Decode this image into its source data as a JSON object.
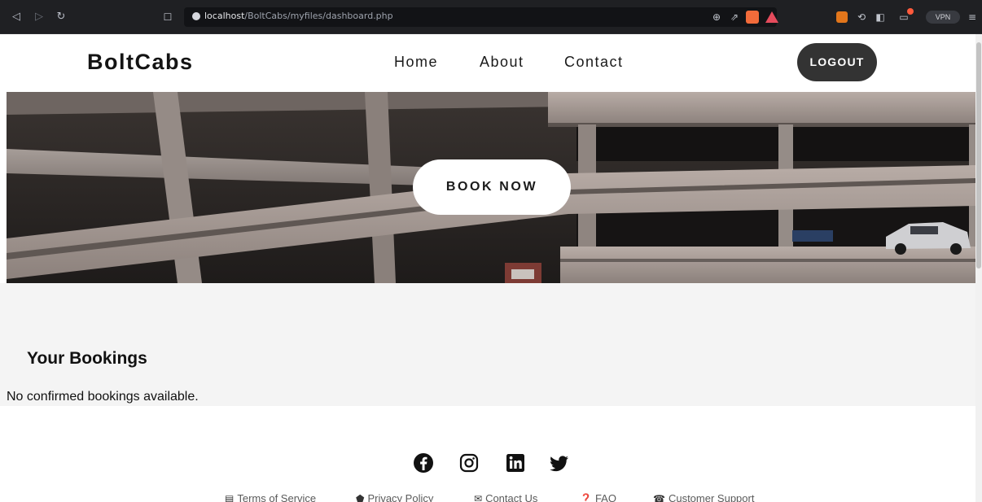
{
  "browser": {
    "url_host": "localhost",
    "url_path": "/BoltCabs/myfiles/dashboard.php",
    "vpn_label": "VPN"
  },
  "header": {
    "logo": "BoltCabs",
    "nav": [
      "Home",
      "About",
      "Contact"
    ],
    "logout_label": "LOGOUT"
  },
  "hero": {
    "cta_label": "BOOK NOW"
  },
  "bookings": {
    "title": "Your Bookings",
    "empty_message": "No confirmed bookings available."
  },
  "footer": {
    "social": [
      "facebook-icon",
      "instagram-icon",
      "linkedin-icon",
      "twitter-icon"
    ],
    "links": [
      {
        "label": "Terms of Service",
        "icon": "document-icon"
      },
      {
        "label": "Privacy Policy",
        "icon": "shield-icon"
      },
      {
        "label": "Contact Us",
        "icon": "envelope-icon"
      },
      {
        "label": "FAQ",
        "icon": "question-icon"
      },
      {
        "label": "Customer Support",
        "icon": "phone-icon"
      }
    ]
  },
  "colors": {
    "logout_bg": "#333333",
    "section_bg": "#f4f4f4",
    "chrome_bg": "#1f2023"
  }
}
